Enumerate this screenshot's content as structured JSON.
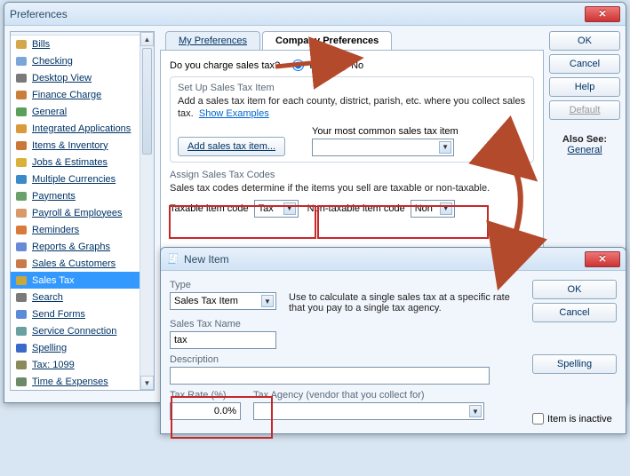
{
  "prefs_window": {
    "title": "Preferences",
    "sidebar": [
      {
        "label": "Bills"
      },
      {
        "label": "Checking"
      },
      {
        "label": "Desktop View"
      },
      {
        "label": "Finance Charge"
      },
      {
        "label": "General"
      },
      {
        "label": "Integrated Applications"
      },
      {
        "label": "Items & Inventory"
      },
      {
        "label": "Jobs & Estimates"
      },
      {
        "label": "Multiple Currencies"
      },
      {
        "label": "Payments"
      },
      {
        "label": "Payroll & Employees"
      },
      {
        "label": "Reminders"
      },
      {
        "label": "Reports & Graphs"
      },
      {
        "label": "Sales & Customers"
      },
      {
        "label": "Sales Tax"
      },
      {
        "label": "Search"
      },
      {
        "label": "Send Forms"
      },
      {
        "label": "Service Connection"
      },
      {
        "label": "Spelling"
      },
      {
        "label": "Tax: 1099"
      },
      {
        "label": "Time & Expenses"
      }
    ],
    "selected_index": 14,
    "tabs": {
      "my": "My Preferences",
      "company": "Company Preferences"
    },
    "question": "Do you charge sales tax?",
    "yes": "Yes",
    "no": "No",
    "setup": {
      "title": "Set Up Sales Tax Item",
      "desc": "Add a sales tax item for each county, district, parish, etc. where you collect sales tax.",
      "show_examples": "Show Examples",
      "add_btn": "Add sales tax item...",
      "common_label": "Your most common sales tax item"
    },
    "assign": {
      "title": "Assign Sales Tax Codes",
      "desc": "Sales tax codes determine if the items you sell are taxable or non-taxable.",
      "taxable_label": "Taxable item code",
      "taxable_value": "Tax",
      "nontax_label": "Non-taxable item code",
      "nontax_value": "Non"
    },
    "buttons": {
      "ok": "OK",
      "cancel": "Cancel",
      "help": "Help",
      "default": "Default"
    },
    "also_see": {
      "heading": "Also See:",
      "value": "General"
    }
  },
  "new_item": {
    "title": "New Item",
    "type_label": "Type",
    "type_value": "Sales Tax Item",
    "type_desc": "Use to calculate a single sales tax at a specific rate that you pay to a single tax agency.",
    "name_label": "Sales Tax Name",
    "name_value": "tax",
    "desc_label": "Description",
    "desc_value": "",
    "rate_label": "Tax Rate (%)",
    "rate_value": "0.0%",
    "agency_label": "Tax Agency (vendor that you collect for)",
    "ok": "OK",
    "cancel": "Cancel",
    "spelling": "Spelling",
    "inactive": "Item is inactive"
  }
}
